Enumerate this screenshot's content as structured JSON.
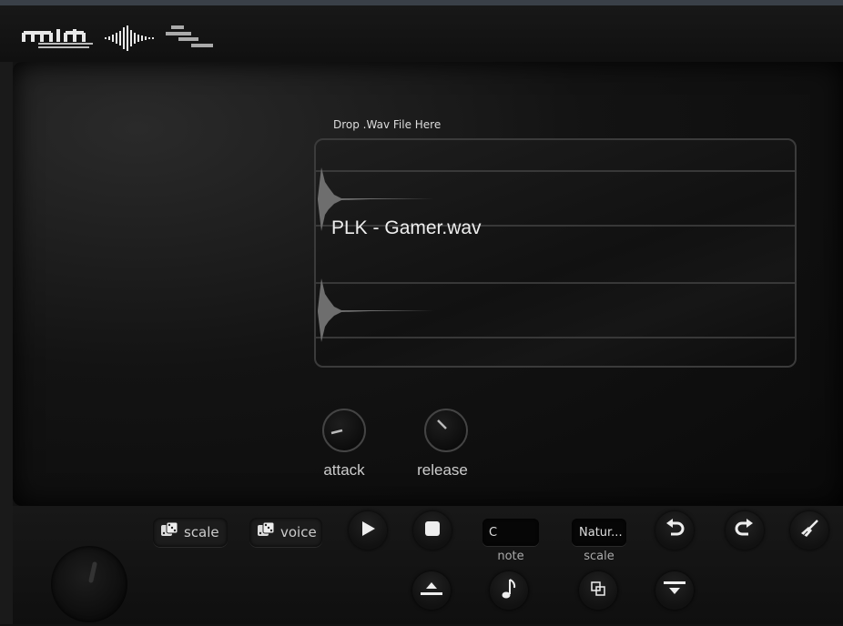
{
  "app": {
    "logo_text": "midi"
  },
  "sample": {
    "drop_label": "Drop .Wav File Here",
    "file_name": "PLK - Gamer.wav"
  },
  "knobs": {
    "attack_label": "attack",
    "release_label": "release",
    "attack_value": 0.1,
    "release_value": 0.35
  },
  "controls": {
    "scale_dice_label": "scale",
    "voice_dice_label": "voice",
    "note_value": "C",
    "note_label": "note",
    "scale_value": "Natur...",
    "scale_label": "scale"
  },
  "icons": [
    "dice-icon",
    "play-icon",
    "stop-icon",
    "undo-icon",
    "redo-icon",
    "brush-icon",
    "eject-icon",
    "note-icon",
    "copy-icon",
    "drop-down-icon"
  ],
  "colors": {
    "background": "#121212",
    "panel": "#0a0a0a",
    "waveform": "#777777",
    "text": "#dddddd"
  }
}
